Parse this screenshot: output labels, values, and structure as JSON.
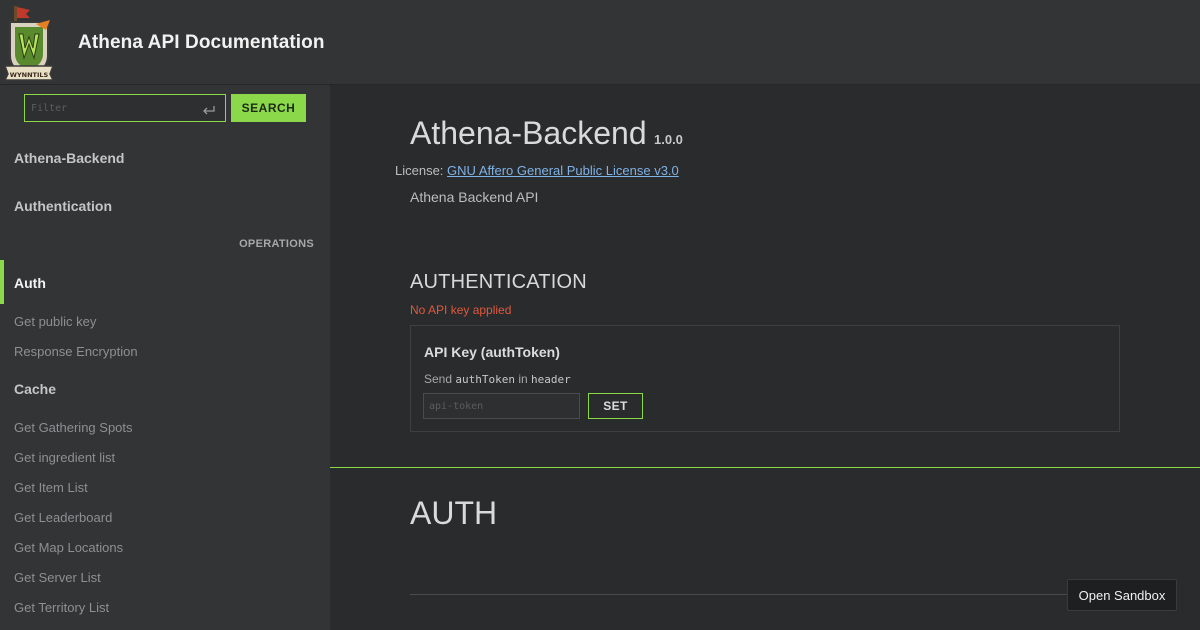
{
  "header": {
    "title": "Athena API Documentation",
    "logo": {
      "icon": "wynntils-logo-icon",
      "text": "WYNNTILS"
    }
  },
  "sidebar": {
    "filter": {
      "placeholder": "Filter",
      "value": ""
    },
    "search_label": "SEARCH",
    "sections": [
      "Athena-Backend",
      "Authentication"
    ],
    "operations_label": "OPERATIONS",
    "groups": [
      {
        "label": "Auth",
        "active": true,
        "items": [
          "Get public key",
          "Response Encryption"
        ]
      },
      {
        "label": "Cache",
        "active": false,
        "items": [
          "Get Gathering Spots",
          "Get ingredient list",
          "Get Item List",
          "Get Leaderboard",
          "Get Map Locations",
          "Get Server List",
          "Get Territory List"
        ]
      }
    ]
  },
  "main": {
    "api_title": "Athena-Backend",
    "version": "1.0.0",
    "license_label": "License:",
    "license_link": "GNU Affero General Public License v3.0",
    "description": "Athena Backend API",
    "authentication": {
      "heading": "AUTHENTICATION",
      "warning": "No API key applied",
      "box_title": "API Key (authToken)",
      "hint_send": "Send",
      "hint_param": "authToken",
      "hint_in": "in",
      "hint_location": "header",
      "token_placeholder": "api-token",
      "set_label": "SET"
    },
    "section_heading": "AUTH"
  },
  "sandbox_label": "Open Sandbox",
  "colors": {
    "accent": "#8bd94a",
    "warning": "#e0583e",
    "link": "#7fb2e5",
    "sidebar_bg": "#333436",
    "main_bg": "#2a2b2d"
  }
}
